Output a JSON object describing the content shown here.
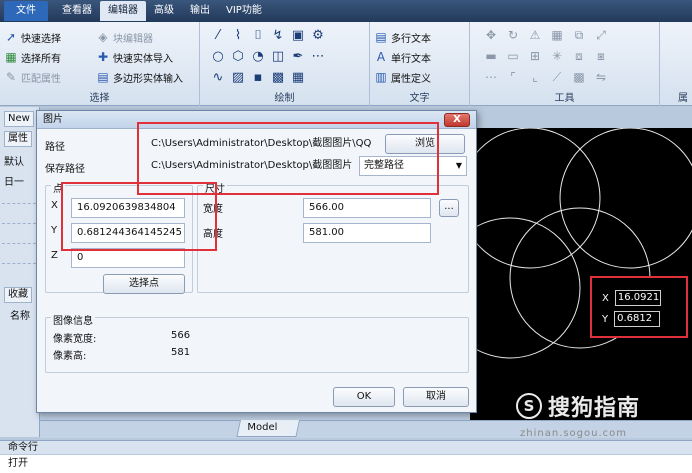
{
  "menubar": {
    "file": "文件",
    "tabs": [
      "查看器",
      "编辑器",
      "高级",
      "输出",
      "VIP功能"
    ],
    "active_index": 1
  },
  "ribbon": {
    "select_group": {
      "label": "选择",
      "items": [
        "快速选择",
        "块编辑器",
        "选择所有",
        "快速实体导入",
        "匹配属性",
        "多边形实体输入"
      ]
    },
    "draw_group": {
      "label": "绘制"
    },
    "text_group": {
      "label": "文字",
      "items": [
        "多行文本",
        "单行文本",
        "属性定义"
      ]
    },
    "tools_group": {
      "label": "工具"
    },
    "last_group_partial": "属"
  },
  "left_panel": {
    "tab_new": "New",
    "tab_property": "属性",
    "default_label": "默认",
    "collapse": "日一",
    "favorites": "收藏",
    "name_label": "名称"
  },
  "dialog": {
    "title": "图片",
    "close": "X",
    "path_label": "路径",
    "path_value": "C:\\Users\\Administrator\\Desktop\\截图图片\\QQ",
    "browse_button": "浏览",
    "save_path_label": "保存路径",
    "save_path_value": "C:\\Users\\Administrator\\Desktop\\截图图片",
    "save_path_mode": "完整路径",
    "point": {
      "label": "点",
      "x_label": "X",
      "x_value": "16.0920639834804",
      "y_label": "Y",
      "y_value": "0.681244364145245",
      "z_label": "Z",
      "z_value": "0",
      "pick_button": "选择点"
    },
    "size": {
      "label": "尺寸",
      "width_label": "宽度",
      "width_value": "566.00",
      "height_label": "高度",
      "height_value": "581.00",
      "ellipsis_button": "..."
    },
    "image_info": {
      "label": "图像信息",
      "pixel_width_label": "像素宽度:",
      "pixel_width_value": "566",
      "pixel_height_label": "像素高:",
      "pixel_height_value": "581"
    },
    "ok_button": "OK",
    "cancel_button": "取消"
  },
  "canvas": {
    "model_tab": "Model",
    "coord_x_label": "X",
    "coord_x_value": "16.0921",
    "coord_y_label": "Y",
    "coord_y_value": "0.6812"
  },
  "watermark": {
    "logo": "S",
    "text": "搜狗指南",
    "url": "zhinan.sogou.com"
  },
  "command": {
    "bar_label": "命令行",
    "line_text": "打开"
  },
  "colors": {
    "highlight_red": "#e0313a",
    "canvas_bg": "#000000",
    "ribbon_bg": "#dfe8f4"
  }
}
